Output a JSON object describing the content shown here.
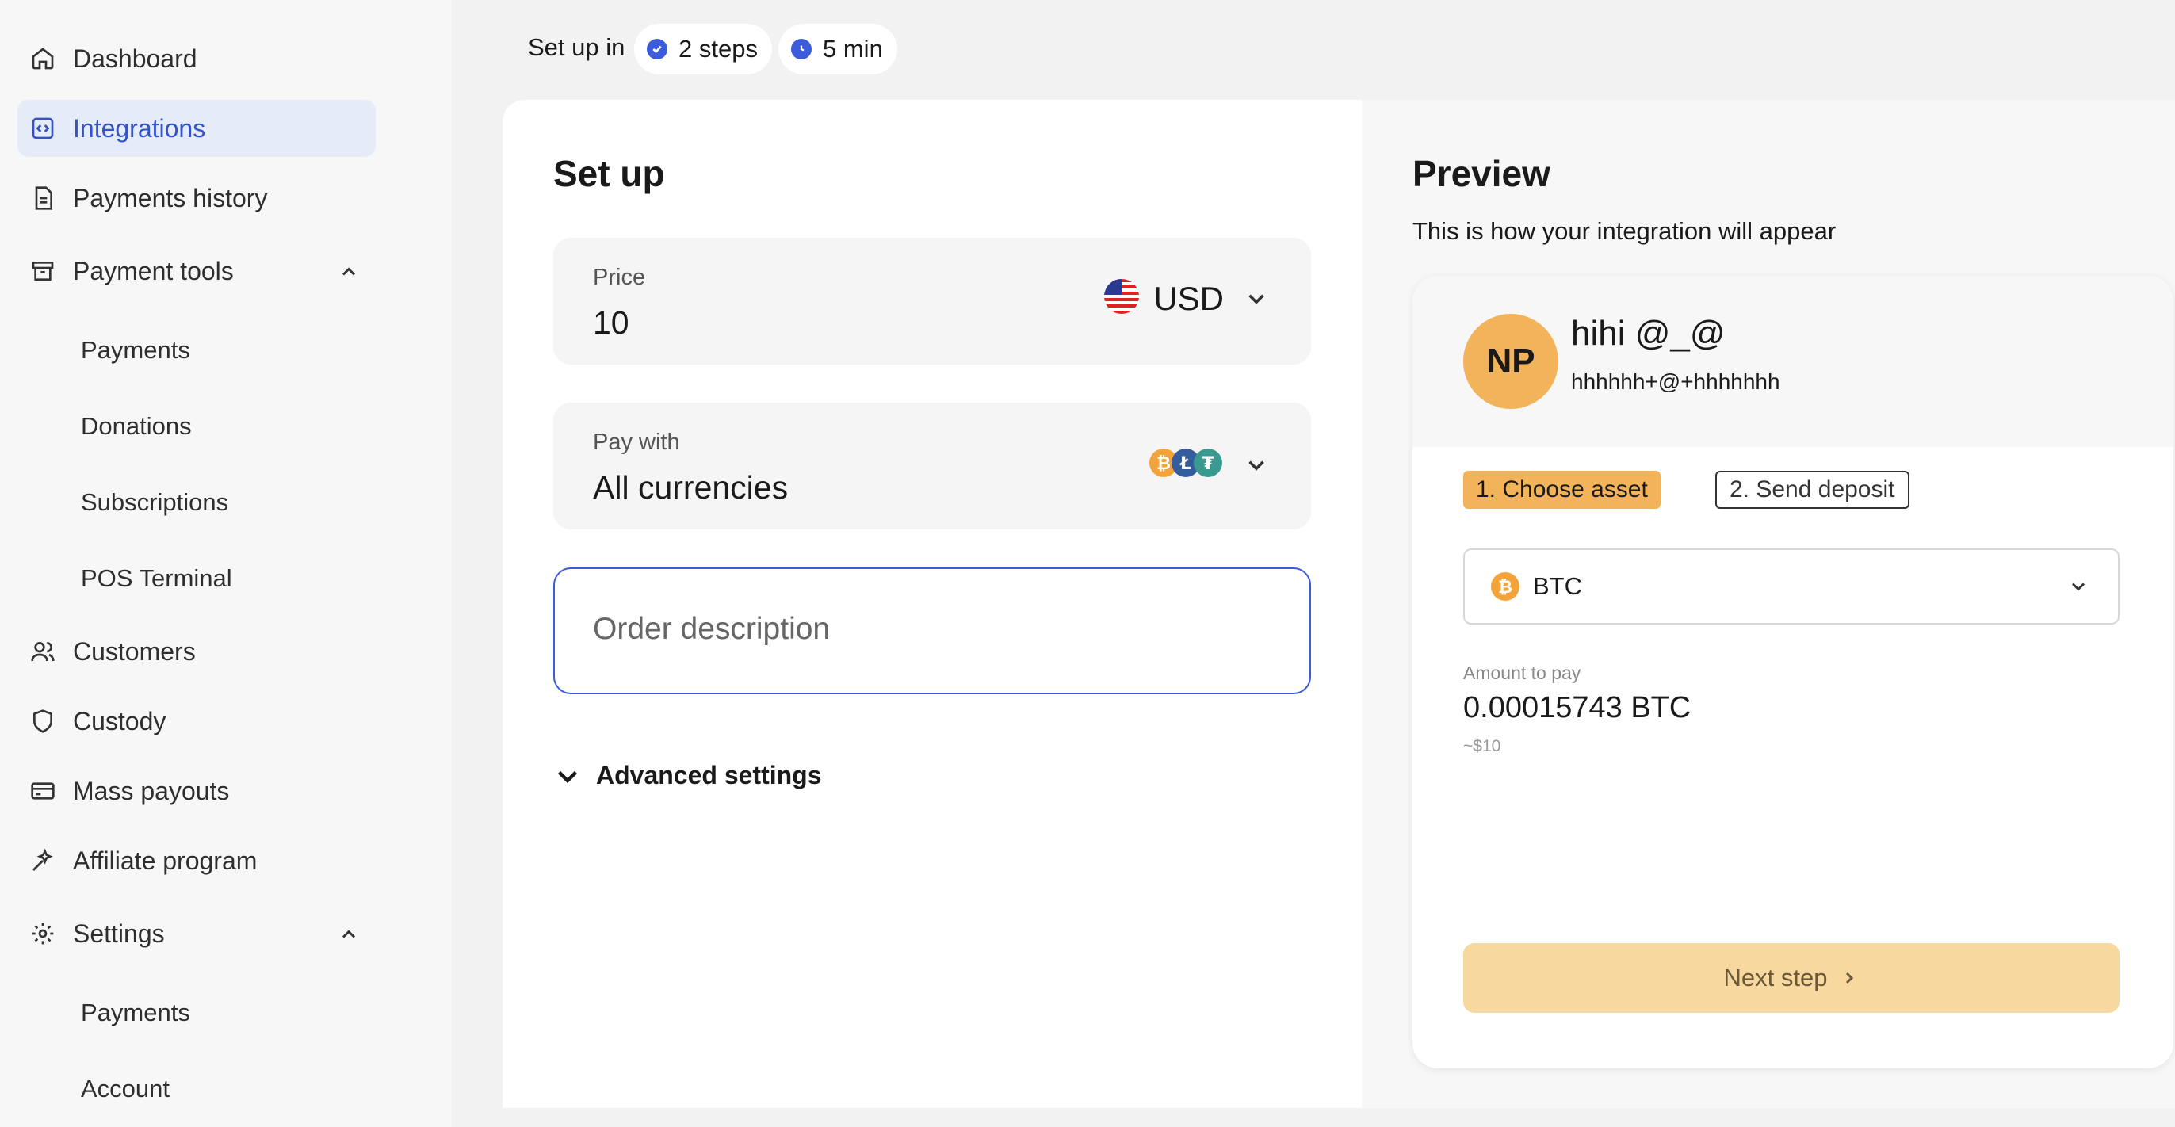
{
  "sidebar": {
    "items": [
      {
        "label": "Dashboard",
        "icon": "home-icon"
      },
      {
        "label": "Integrations",
        "icon": "code-icon",
        "active": true
      },
      {
        "label": "Payments history",
        "icon": "document-icon"
      },
      {
        "label": "Payment tools",
        "icon": "archive-icon",
        "expanded": true
      },
      {
        "label": "Customers",
        "icon": "users-icon"
      },
      {
        "label": "Custody",
        "icon": "shield-icon"
      },
      {
        "label": "Mass payouts",
        "icon": "card-icon"
      },
      {
        "label": "Affiliate program",
        "icon": "sparkle-icon"
      },
      {
        "label": "Settings",
        "icon": "gear-icon",
        "expanded": true
      }
    ],
    "payment_tools_sub": [
      "Payments",
      "Donations",
      "Subscriptions",
      "POS Terminal"
    ],
    "settings_sub": [
      "Payments",
      "Account"
    ]
  },
  "topbar": {
    "lead": "Set up in",
    "steps": "2 steps",
    "time": "5 min"
  },
  "setup": {
    "title": "Set up",
    "price_label": "Price",
    "price_value": "10",
    "currency": "USD",
    "pay_with_label": "Pay with",
    "pay_with_value": "All currencies",
    "order_placeholder": "Order description",
    "advanced": "Advanced settings"
  },
  "preview": {
    "title": "Preview",
    "subtitle": "This is how your integration will appear",
    "avatar_initials": "NP",
    "merchant_name": "hihi @_@",
    "merchant_email": "hhhhhh+@+hhhhhhh",
    "step1": "1. Choose asset",
    "step2": "2. Send deposit",
    "asset": "BTC",
    "amount_label": "Amount to pay",
    "amount": "0.00015743 BTC",
    "amount_usd": "~$10",
    "next_button": "Next step"
  },
  "colors": {
    "accent": "#3b5bdb",
    "active_nav_bg": "#e6ebf8",
    "brand_orange": "#f2b35a",
    "next_button_bg": "#f7d89f"
  }
}
